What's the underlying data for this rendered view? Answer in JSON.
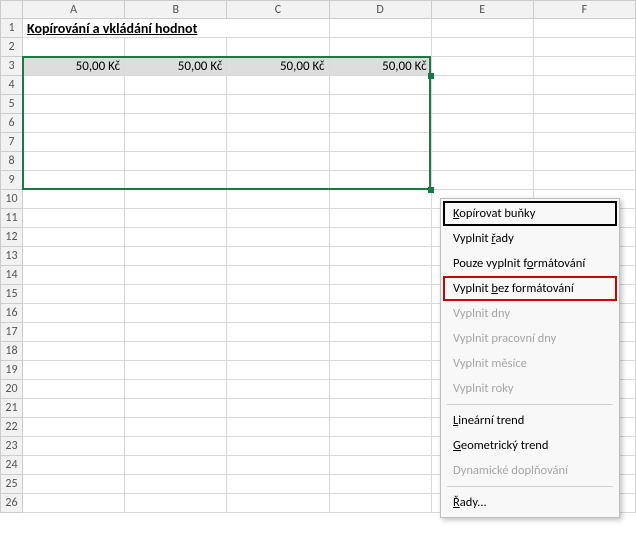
{
  "columns": [
    "A",
    "B",
    "C",
    "D",
    "E",
    "F"
  ],
  "row_count": 26,
  "title_cell": {
    "row": 1,
    "col": "A",
    "text": "Kopírování a vkládání hodnot"
  },
  "values_row3": [
    "50,00 Kč",
    "50,00 Kč",
    "50,00 Kč",
    "50,00 Kč"
  ],
  "selection": {
    "from_col": "A",
    "to_col": "D",
    "from_row": 3,
    "to_row": 9
  },
  "menu": {
    "items": [
      {
        "label": "Kopírovat buňky",
        "mnemonic": 0,
        "disabled": false,
        "box": "black"
      },
      {
        "label": "Vyplnit řady",
        "mnemonic": 8,
        "disabled": false
      },
      {
        "label": "Pouze vyplnit formátování",
        "mnemonic": 15,
        "disabled": false
      },
      {
        "label": "Vyplnit bez formátování",
        "mnemonic": 8,
        "disabled": false,
        "box": "red"
      },
      {
        "label": "Vyplnit dny",
        "disabled": true
      },
      {
        "label": "Vyplnit pracovní dny",
        "disabled": true
      },
      {
        "label": "Vyplnit měsíce",
        "disabled": true
      },
      {
        "label": "Vyplnit roky",
        "disabled": true
      },
      {
        "sep": true
      },
      {
        "label": "Lineární trend",
        "mnemonic": 0,
        "disabled": false
      },
      {
        "label": "Geometrický trend",
        "mnemonic": 0,
        "disabled": false
      },
      {
        "label": "Dynamické doplňování",
        "disabled": true
      },
      {
        "sep": true
      },
      {
        "label": "Řady...",
        "mnemonic": 0,
        "disabled": false
      }
    ]
  }
}
